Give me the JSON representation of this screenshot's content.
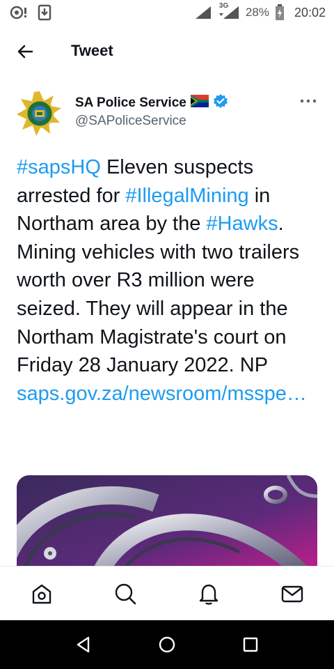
{
  "status_bar": {
    "network": "3G",
    "battery": "28%",
    "time": "20:02"
  },
  "header": {
    "title": "Tweet"
  },
  "tweet": {
    "author_name": "SA Police Service",
    "author_handle": "@SAPoliceService",
    "text_parts": [
      {
        "text": "#sapsHQ",
        "link": true
      },
      {
        "text": " Eleven suspects arrested for ",
        "link": false
      },
      {
        "text": "#IllegalMining",
        "link": true
      },
      {
        "text": " in Northam area by the ",
        "link": false
      },
      {
        "text": "#Hawks",
        "link": true
      },
      {
        "text": ". Mining vehicles with two trailers worth over R3 million were seized. They will appear in the Northam Magistrate's court on Friday 28 January 2022. NP ",
        "link": false
      },
      {
        "text": "saps.gov.za/newsroom/msspe…",
        "link": true
      }
    ],
    "media_description_icon": "handcuffs-photo"
  },
  "bottom_nav": {
    "items": [
      "home-icon",
      "search-icon",
      "notifications-icon",
      "messages-icon"
    ]
  },
  "system_nav": {
    "items": [
      "back-triangle-icon",
      "home-circle-icon",
      "recents-square-icon"
    ]
  },
  "colors": {
    "link": "#1d9bf0",
    "text": "#0f1419",
    "muted": "#536471",
    "verified": "#1d9bf0"
  }
}
